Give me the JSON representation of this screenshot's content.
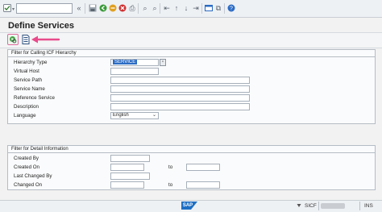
{
  "window": {
    "title": "Define Services"
  },
  "status": {
    "transaction": "SICF",
    "mode": "INS"
  },
  "filter_calling": {
    "title": "Filter for Calling ICF Hierarchy",
    "hierarchy_type_label": "Hierarchy Type",
    "hierarchy_type_value": "SERVICE",
    "virtual_host_label": "Virtual Host",
    "service_path_label": "Service Path",
    "service_name_label": "Service Name",
    "reference_service_label": "Reference Service",
    "description_label": "Description",
    "language_label": "Language",
    "language_value": "English"
  },
  "filter_detail": {
    "title": "Filter for Detail Information",
    "created_by_label": "Created By",
    "created_on_label": "Created On",
    "to_label": "to",
    "last_changed_by_label": "Last Changed By",
    "changed_on_label": "Changed On"
  },
  "colors": {
    "accent": "#2c6cc4",
    "arrow": "#e84a8a"
  }
}
